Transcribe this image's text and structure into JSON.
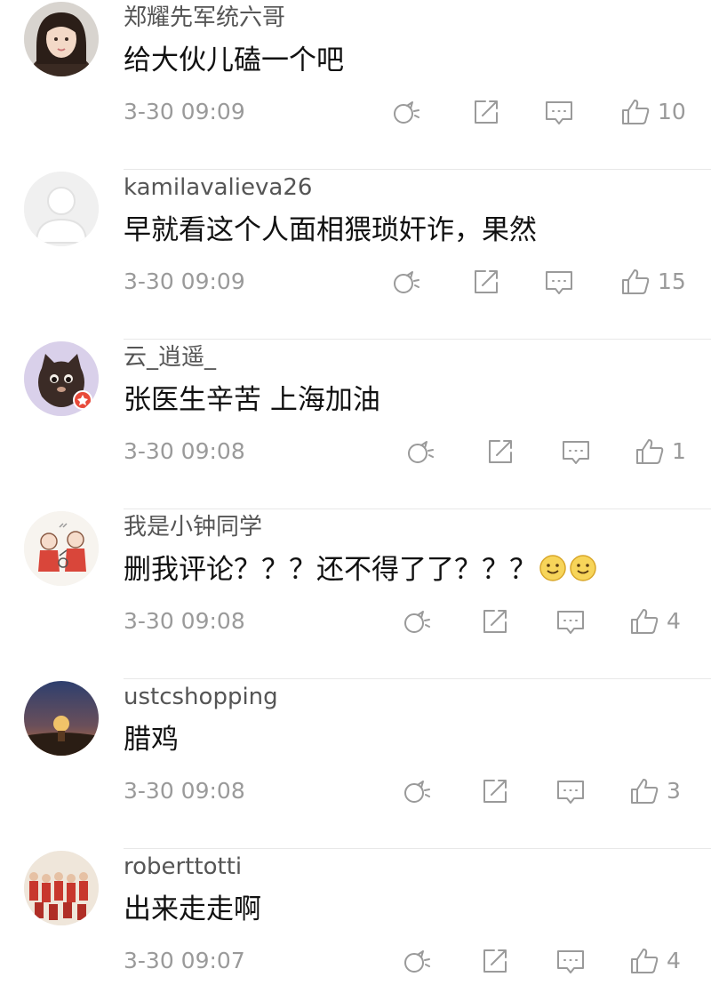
{
  "colors": {
    "username": "#555555",
    "text": "#111111",
    "meta": "#9a9a9a",
    "divider": "#e8e8e8"
  },
  "icons": {
    "repost": "repost-icon",
    "share": "share-icon",
    "reply": "comment-icon",
    "like": "thumbs-up-icon"
  },
  "comments": [
    {
      "username": "郑耀先军统六哥",
      "text": "给大伙儿磕一个吧",
      "timestamp": "3-30 09:09",
      "likes": "10"
    },
    {
      "username": "kamilavalieva26",
      "text": "早就看这个人面相猥琐奸诈，果然",
      "timestamp": "3-30 09:09",
      "likes": "15"
    },
    {
      "username": "云_逍遥_",
      "text": "张医生辛苦 上海加油",
      "timestamp": "3-30 09:08",
      "likes": "1"
    },
    {
      "username": "我是小钟同学",
      "text": "删我评论？？？还不得了了？？？",
      "timestamp": "3-30 09:08",
      "likes": "4"
    },
    {
      "username": "ustcshopping",
      "text": "腊鸡",
      "timestamp": "3-30 09:08",
      "likes": "3"
    },
    {
      "username": "roberttotti",
      "text": "出来走走啊",
      "timestamp": "3-30 09:07",
      "likes": "4"
    }
  ]
}
